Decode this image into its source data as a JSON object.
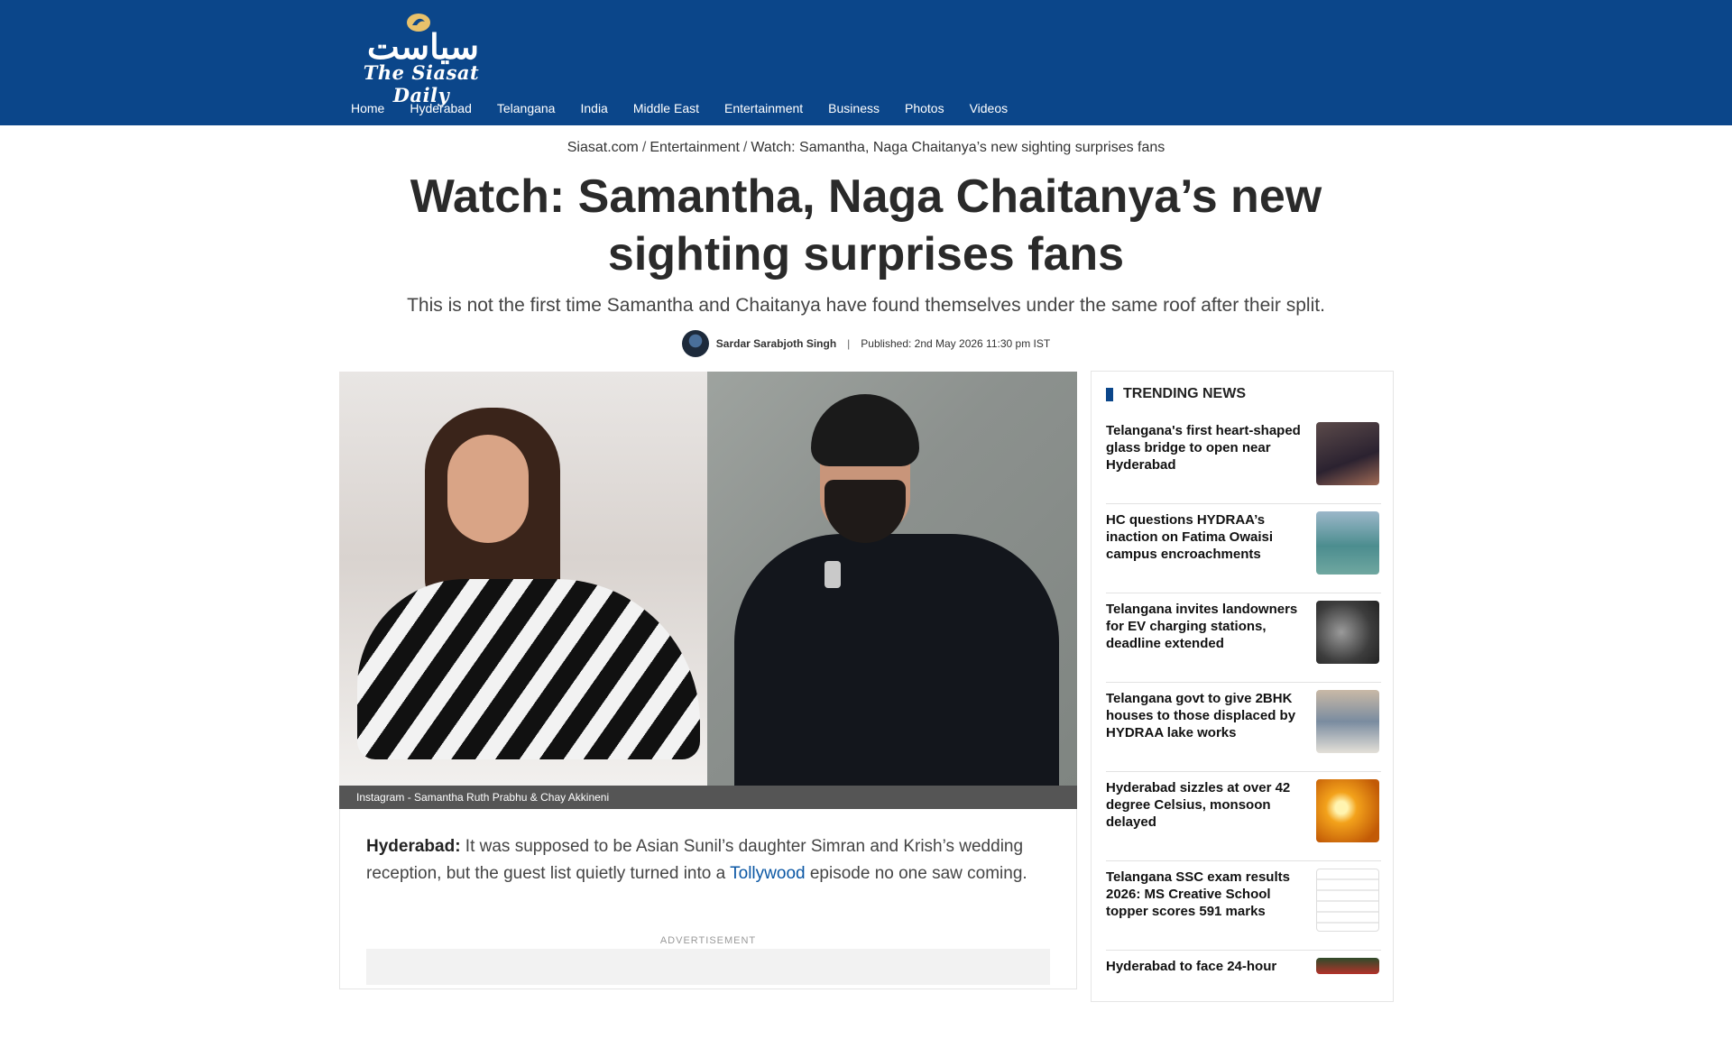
{
  "site": {
    "logo_urdu": "سیاست",
    "logo_english": "The Siasat Daily"
  },
  "nav": [
    "Home",
    "Hyderabad",
    "Telangana",
    "India",
    "Middle East",
    "Entertainment",
    "Business",
    "Photos",
    "Videos"
  ],
  "breadcrumb": {
    "home": "Siasat.com",
    "section": "Entertainment",
    "current": "Watch: Samantha, Naga Chaitanya’s new sighting surprises fans",
    "separator": "/"
  },
  "article": {
    "title": "Watch: Samantha, Naga Chaitanya’s new sighting surprises fans",
    "subtitle": "This is not the first time Samantha and Chaitanya have found themselves under the same roof after their split.",
    "author": "Sardar Sarabjoth Singh",
    "byline_separator": "|",
    "published": "Published: 2nd May 2026 11:30 pm IST",
    "image_caption": "Instagram - Samantha Ruth Prabhu & Chay Akkineni",
    "lead_dateline": "Hyderabad:",
    "lead_text_before": " It was supposed to be Asian Sunil’s daughter Simran and Krish’s wedding reception, but the guest list quietly turned into a ",
    "lead_link": "Tollywood",
    "lead_text_after": " episode no one saw coming.",
    "ad_label": "ADVERTISEMENT"
  },
  "trending": {
    "heading": "TRENDING NEWS",
    "items": [
      {
        "title": "Telangana's first heart-shaped glass bridge to open near Hyderabad"
      },
      {
        "title": "HC questions HYDRAA’s inaction on Fatima Owaisi campus encroachments"
      },
      {
        "title": "Telangana invites landowners for EV charging stations, deadline extended"
      },
      {
        "title": "Telangana govt to give 2BHK houses to those displaced by HYDRAA lake works"
      },
      {
        "title": "Hyderabad sizzles at over 42 degree Celsius, monsoon delayed"
      },
      {
        "title": "Telangana SSC exam results 2026: MS Creative School topper scores 591 marks"
      },
      {
        "title": "Hyderabad to face 24-hour"
      }
    ]
  },
  "colors": {
    "header_blue": "#0b468a",
    "link_blue": "#0b57a4"
  }
}
